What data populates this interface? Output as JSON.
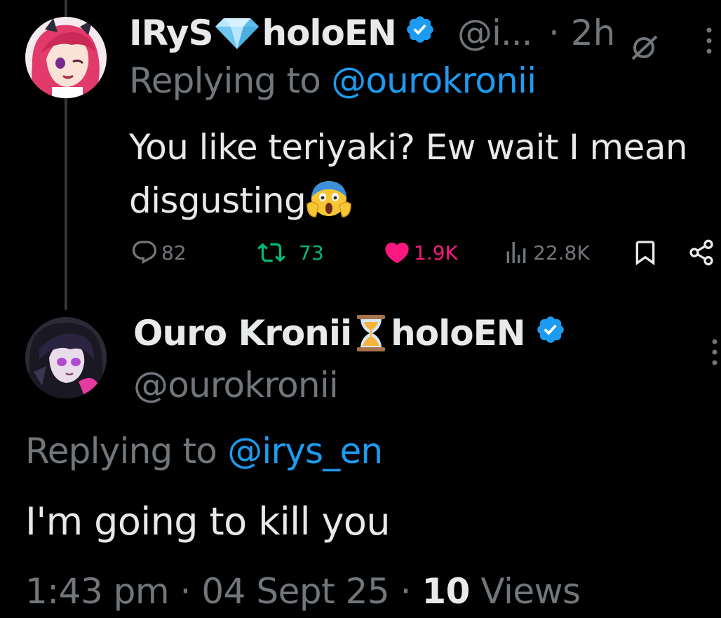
{
  "reply_tweet": {
    "author": {
      "display_name": "IRyS",
      "affiliation": "holoEN",
      "handle_truncated": "@i...",
      "time_separator": "·",
      "time": "2h",
      "verified": true
    },
    "replying_prefix": "Replying to ",
    "replying_handle": "@ourokronii",
    "body_line1": "You like teriyaki? Ew wait I mean",
    "body_line2": "disgusting",
    "actions": {
      "replies": "82",
      "reposts": "73",
      "likes": "1.9K",
      "views": "22.8K"
    },
    "colors": {
      "repost": "#00ba7c",
      "like": "#f91880",
      "link": "#1d9bf0",
      "muted": "#71767b"
    }
  },
  "main_tweet": {
    "author": {
      "display_name": "Ouro Kronii",
      "affiliation": "holoEN",
      "handle": "@ourokronii",
      "verified": true
    },
    "replying_prefix": "Replying to ",
    "replying_handle": "@irys_en",
    "body": "I'm going to kill you",
    "meta": {
      "time": "1:43 pm",
      "sep1": " · ",
      "date": "04 Sept 25",
      "sep2": " · ",
      "views_count": "10",
      "views_label": " Views"
    }
  },
  "icons": {
    "gem": "gem-emoji",
    "hourglass": "hourglass-emoji",
    "scream": "screaming-face-emoji",
    "verified": "verified-badge-icon",
    "grok": "grok-icon",
    "more": "more-vertical-icon"
  }
}
